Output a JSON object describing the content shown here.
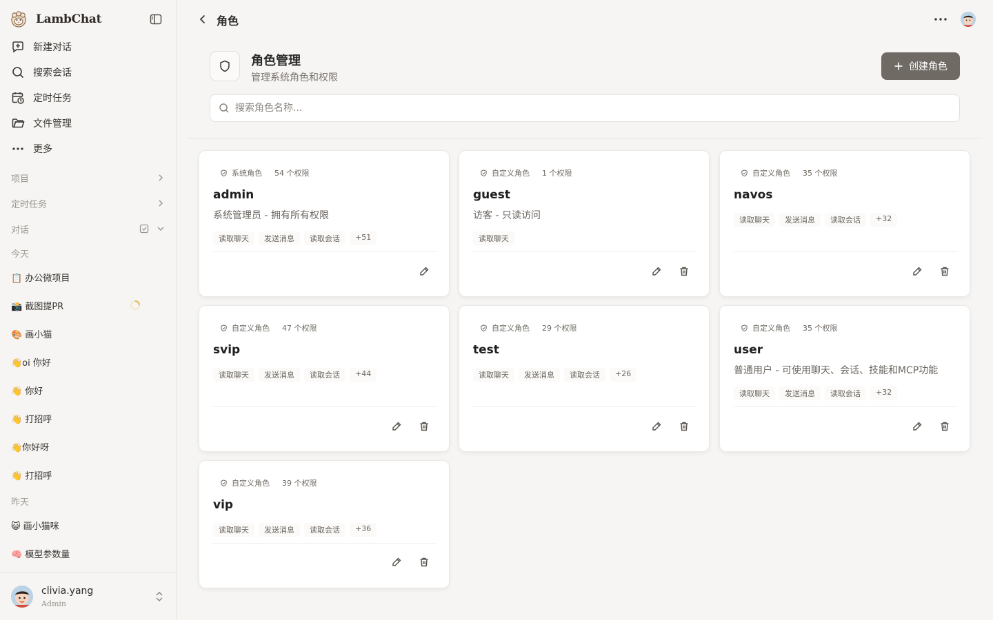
{
  "brand": {
    "name": "LambChat"
  },
  "nav": [
    {
      "id": "new",
      "label": "新建对话",
      "icon": "new-chat-icon"
    },
    {
      "id": "search",
      "label": "搜索会话",
      "icon": "search-icon"
    },
    {
      "id": "tasks",
      "label": "定时任务",
      "icon": "calendar-clock-icon"
    },
    {
      "id": "files",
      "label": "文件管理",
      "icon": "folder-icon"
    },
    {
      "id": "more",
      "label": "更多",
      "icon": "more-dots-icon"
    }
  ],
  "sections": {
    "projects": "项目",
    "scheduled": "定时任务",
    "conversations": "对话"
  },
  "groups": {
    "today": "今天",
    "yesterday": "昨天"
  },
  "conversations_today": [
    "📋 办公微项目",
    "📸 截图提PR",
    "🎨 画小猫",
    "👋oi 你好",
    "👋 你好",
    "👋 打招呼",
    "👋你好呀",
    "👋 打招呼"
  ],
  "conversations_yesterday": [
    "😺 画小猫咪",
    "🧠 模型参数量"
  ],
  "user": {
    "name": "clivia.yang",
    "role": "Admin"
  },
  "header": {
    "top_title": "角色",
    "title": "角色管理",
    "subtitle": "管理系统角色和权限",
    "create_label": "创建角色"
  },
  "search": {
    "placeholder": "搜索角色名称..."
  },
  "roles": [
    {
      "type": "系统角色",
      "count": "54 个权限",
      "name": "admin",
      "desc": "系统管理员 - 拥有所有权限",
      "tags": [
        "读取聊天",
        "发送消息",
        "读取会话",
        "+51"
      ],
      "deletable": false
    },
    {
      "type": "自定义角色",
      "count": "1 个权限",
      "name": "guest",
      "desc": "访客 - 只读访问",
      "tags": [
        "读取聊天"
      ],
      "deletable": true
    },
    {
      "type": "自定义角色",
      "count": "35 个权限",
      "name": "navos",
      "desc": "",
      "tags": [
        "读取聊天",
        "发送消息",
        "读取会话",
        "+32"
      ],
      "deletable": true
    },
    {
      "type": "自定义角色",
      "count": "47 个权限",
      "name": "svip",
      "desc": "",
      "tags": [
        "读取聊天",
        "发送消息",
        "读取会话",
        "+44"
      ],
      "deletable": true
    },
    {
      "type": "自定义角色",
      "count": "29 个权限",
      "name": "test",
      "desc": "",
      "tags": [
        "读取聊天",
        "发送消息",
        "读取会话",
        "+26"
      ],
      "deletable": true
    },
    {
      "type": "自定义角色",
      "count": "35 个权限",
      "name": "user",
      "desc": "普通用户 - 可使用聊天、会话、技能和MCP功能",
      "tags": [
        "读取聊天",
        "发送消息",
        "读取会话",
        "+32"
      ],
      "deletable": true
    },
    {
      "type": "自定义角色",
      "count": "39 个权限",
      "name": "vip",
      "desc": "",
      "tags": [
        "读取聊天",
        "发送消息",
        "读取会话",
        "+36"
      ],
      "deletable": true
    }
  ]
}
